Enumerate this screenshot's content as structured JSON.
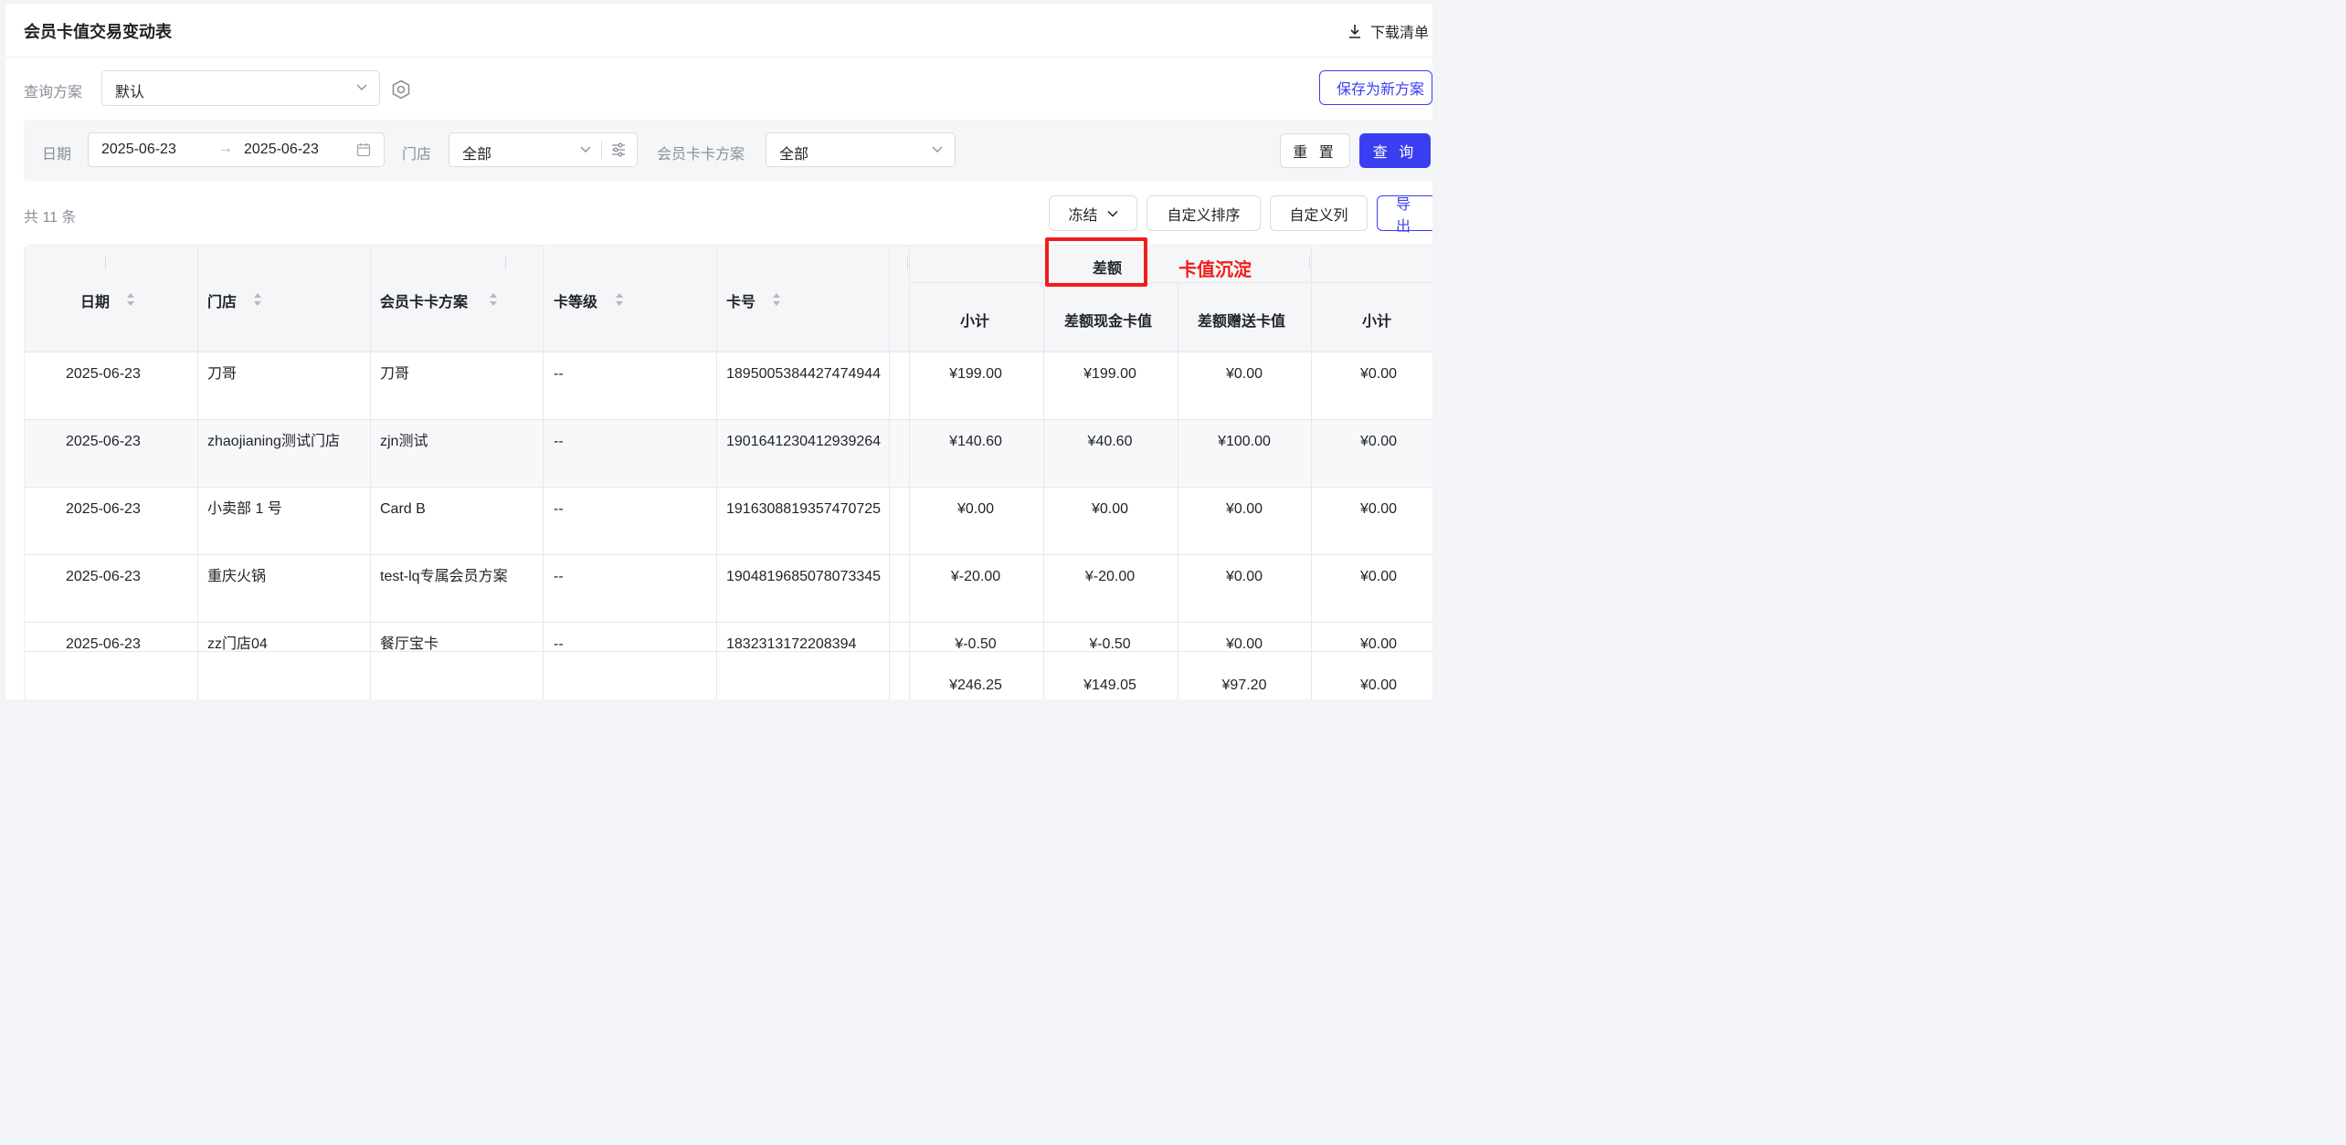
{
  "header": {
    "title": "会员卡值交易变动表",
    "download_label": "下载清单"
  },
  "scheme": {
    "label": "查询方案",
    "value": "默认",
    "save_label": "保存为新方案"
  },
  "filters": {
    "date_label": "日期",
    "date_start": "2025-06-23",
    "date_end": "2025-06-23",
    "store_label": "门店",
    "store_value": "全部",
    "card_scheme_label": "会员卡卡方案",
    "card_scheme_value": "全部",
    "reset_label": "重 置",
    "query_label": "查 询"
  },
  "toolbar": {
    "count": "共 11 条",
    "freeze_label": "冻结",
    "custom_sort_label": "自定义排序",
    "custom_columns_label": "自定义列",
    "export_label": "导 出"
  },
  "table": {
    "columns": {
      "date": "日期",
      "store": "门店",
      "card_scheme": "会员卡卡方案",
      "card_level": "卡等级",
      "card_no": "卡号",
      "diff_group": "差额",
      "subtotal": "小计",
      "diff_cash": "差额现金卡值",
      "diff_gift": "差额赠送卡值",
      "subtotal2": "小计"
    },
    "rows": [
      {
        "date": "2025-06-23",
        "store": "刀哥",
        "card_scheme": "刀哥",
        "level": "--",
        "card_no": "1895005384427474944",
        "subtotal": "¥199.00",
        "cash": "¥199.00",
        "gift": "¥0.00",
        "subtotal2": "¥0.00"
      },
      {
        "date": "2025-06-23",
        "store": "zhaojianing测试门店",
        "card_scheme": "zjn测试",
        "level": "--",
        "card_no": "1901641230412939264",
        "subtotal": "¥140.60",
        "cash": "¥40.60",
        "gift": "¥100.00",
        "subtotal2": "¥0.00"
      },
      {
        "date": "2025-06-23",
        "store": "小卖部 1 号",
        "card_scheme": "Card B",
        "level": "--",
        "card_no": "1916308819357470725",
        "subtotal": "¥0.00",
        "cash": "¥0.00",
        "gift": "¥0.00",
        "subtotal2": "¥0.00"
      },
      {
        "date": "2025-06-23",
        "store": "重庆火锅",
        "card_scheme": "test-lq专属会员方案",
        "level": "--",
        "card_no": "1904819685078073345",
        "subtotal": "¥-20.00",
        "cash": "¥-20.00",
        "gift": "¥0.00",
        "subtotal2": "¥0.00"
      },
      {
        "date": "2025-06-23",
        "store": "zz门店04",
        "card_scheme": "餐厅宝卡",
        "level": "--",
        "card_no": "1832313172208394",
        "subtotal": "¥-0.50",
        "cash": "¥-0.50",
        "gift": "¥0.00",
        "subtotal2": "¥0.00"
      }
    ],
    "totals": {
      "subtotal": "¥246.25",
      "cash": "¥149.05",
      "gift": "¥97.20",
      "subtotal2": "¥0.00"
    }
  },
  "annotation": {
    "text": "卡值沉淀"
  },
  "colors": {
    "primary": "#3b3ef0",
    "annotation_red": "#f21d1d",
    "header_bg": "#f5f6f8"
  }
}
